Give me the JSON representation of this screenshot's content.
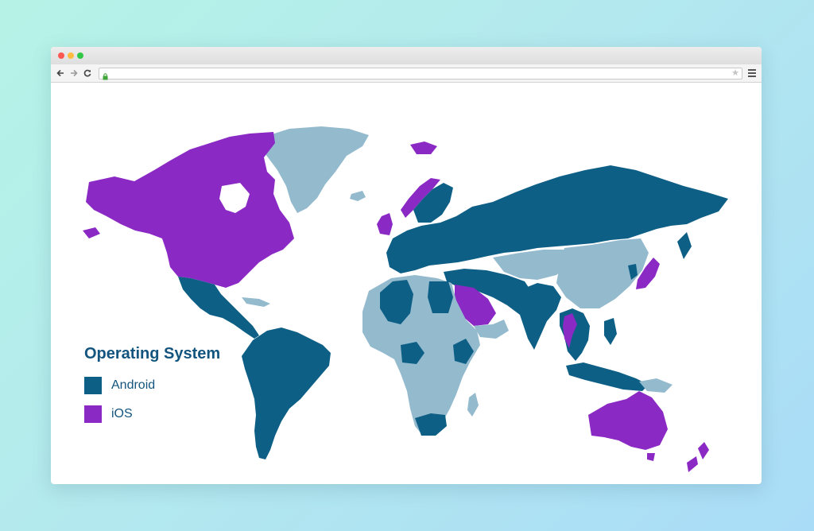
{
  "browser": {
    "address": "",
    "icons": {
      "back": "arrow-left-icon",
      "forward": "arrow-right-icon",
      "reload": "reload-icon",
      "lock": "lock-icon",
      "bookmark": "star-icon",
      "menu": "hamburger-menu-icon"
    }
  },
  "map": {
    "title": "Operating System",
    "legend": [
      {
        "label": "Android",
        "color": "#0e5f86"
      },
      {
        "label": "iOS",
        "color": "#8a29c4"
      }
    ],
    "colors": {
      "android": "#0e5f86",
      "ios": "#8a29c4",
      "no_data": "#94bace",
      "background": "#ffffff"
    },
    "regions": {
      "ios": [
        "Canada",
        "United States",
        "Greenland-adjacent islands (Svalbard)",
        "United Kingdom",
        "Norway",
        "Saudi Arabia",
        "Thailand",
        "Japan",
        "Australia",
        "New Zealand"
      ],
      "android": [
        "Mexico",
        "Central America",
        "South America",
        "Russia",
        "Europe",
        "Turkey",
        "Iran",
        "India",
        "Southeast Asia",
        "Indonesia",
        "Egypt",
        "Algeria",
        "South Africa"
      ],
      "no_data": [
        "Greenland",
        "China",
        "Mongolia",
        "Kazakhstan",
        "Most of Africa",
        "Arabian neighbours"
      ]
    }
  }
}
